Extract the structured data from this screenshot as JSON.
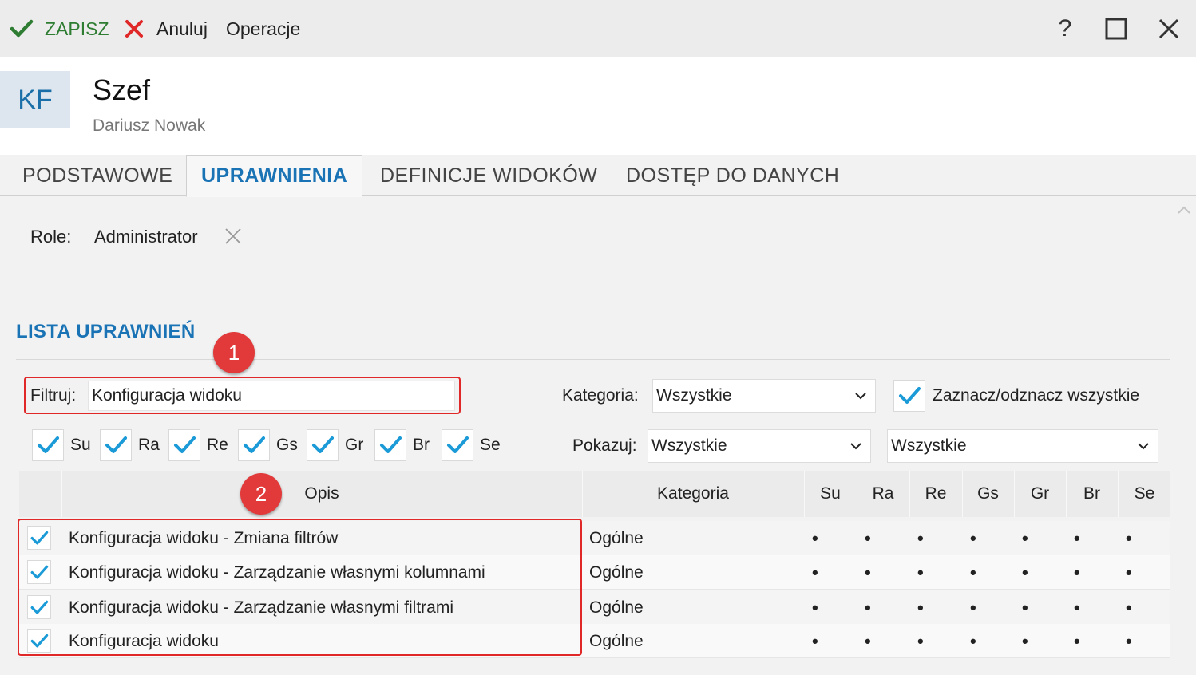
{
  "toolbar": {
    "save": "ZAPISZ",
    "cancel": "Anuluj",
    "operations": "Operacje",
    "help": "?"
  },
  "header": {
    "initials": "KF",
    "name": "Szef",
    "subname": "Dariusz Nowak"
  },
  "tabs": [
    {
      "label": "PODSTAWOWE"
    },
    {
      "label": "UPRAWNIENIA"
    },
    {
      "label": "DEFINICJE WIDOKÓW"
    },
    {
      "label": "DOSTĘP DO DANYCH"
    }
  ],
  "role": {
    "label": "Role:",
    "value": "Administrator"
  },
  "section": {
    "title": "LISTA UPRAWNIEŃ"
  },
  "badges": [
    "1",
    "2"
  ],
  "filter": {
    "label": "Filtruj:",
    "value": "Konfiguracja widoku"
  },
  "category": {
    "label": "Kategoria:",
    "value": "Wszystkie"
  },
  "select_all": {
    "label": "Zaznacz/odznacz wszystkie",
    "checked": true
  },
  "show": {
    "label": "Pokazuj:",
    "value1": "Wszystkie",
    "value2": "Wszystkie"
  },
  "modules": [
    "Su",
    "Ra",
    "Re",
    "Gs",
    "Gr",
    "Br",
    "Se"
  ],
  "table": {
    "columns": {
      "opis": "Opis",
      "kategoria": "Kategoria"
    },
    "rows": [
      {
        "opis": "Konfiguracja widoku - Zmiana filtrów",
        "kategoria": "Ogólne",
        "checked": true,
        "dots": [
          "•",
          "•",
          "•",
          "•",
          "•",
          "•",
          "•"
        ]
      },
      {
        "opis": "Konfiguracja widoku - Zarządzanie własnymi kolumnami",
        "kategoria": "Ogólne",
        "checked": true,
        "dots": [
          "•",
          "•",
          "•",
          "•",
          "•",
          "•",
          "•"
        ]
      },
      {
        "opis": "Konfiguracja widoku - Zarządzanie własnymi filtrami",
        "kategoria": "Ogólne",
        "checked": true,
        "dots": [
          "•",
          "•",
          "•",
          "•",
          "•",
          "•",
          "•"
        ]
      },
      {
        "opis": "Konfiguracja widoku",
        "kategoria": "Ogólne",
        "checked": true,
        "dots": [
          "•",
          "•",
          "•",
          "•",
          "•",
          "•",
          "•"
        ]
      }
    ]
  },
  "colors": {
    "accent": "#1a73b5",
    "save_green": "#2e7d32",
    "cancel_red": "#e02828",
    "check_blue": "#1a9ad6",
    "badge_red": "#e23a3a"
  },
  "icons": [
    "check-icon",
    "close-icon",
    "help-icon",
    "maximize-icon",
    "chevron-down-icon",
    "remove-role-icon"
  ]
}
